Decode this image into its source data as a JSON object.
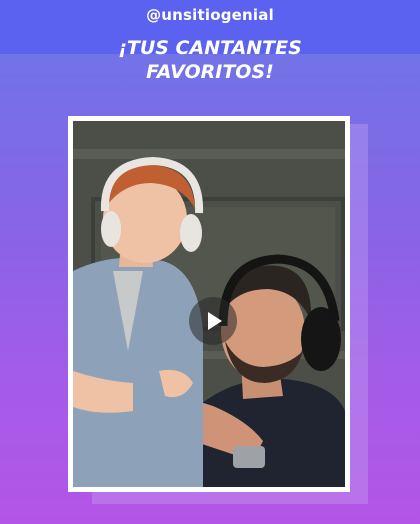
{
  "header": {
    "handle": "@unsitiogenial",
    "headline_line1": "¡TUS CANTANTES",
    "headline_line2": "FAVORITOS!"
  },
  "video": {
    "play_icon": "play-icon"
  },
  "colors": {
    "top_bar": "#5b62f0",
    "gradient_top": "#6a78e6",
    "gradient_bottom": "#b355e6",
    "frame": "#ffffff"
  }
}
